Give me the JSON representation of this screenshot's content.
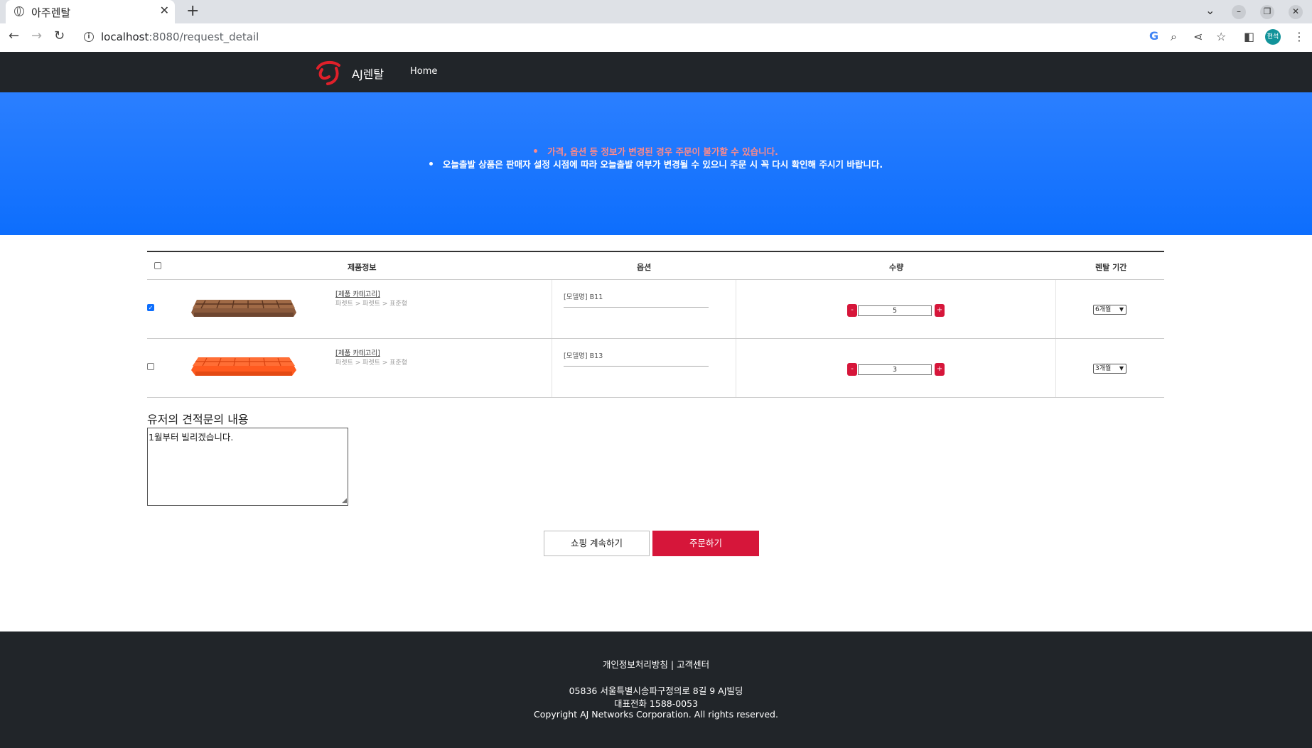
{
  "browser": {
    "tab_title": "아주렌탈",
    "url_host": "localhost",
    "url_rest": ":8080/request_detail",
    "profile_initials": "현석"
  },
  "nav": {
    "brand": "AJ렌탈",
    "home": "Home"
  },
  "hero": {
    "notice_1": "가격, 옵션 등 정보가 변경된 경우 주문이 불가할 수 있습니다.",
    "notice_2": "오늘출발 상품은 판매자 설정 시점에 따라 오늘출발 여부가 변경될 수 있으니 주문 시 꼭 다시 확인해 주시기 바랍니다.",
    "notice_1_color": "#ff8a8a",
    "background": "#0d6efd"
  },
  "table": {
    "headers": {
      "product": "제품정보",
      "option": "옵션",
      "quantity": "수량",
      "period": "렌탈 기간"
    },
    "rows": [
      {
        "checked": true,
        "category": "[제품 카테고리]",
        "breadcrumb": "파렛트 > 파렛트 > 표준형",
        "option": "[모델명] B11",
        "quantity": "5",
        "period": "6개월",
        "image_color": "brown-pallet"
      },
      {
        "checked": false,
        "category": "[제품 카테고리]",
        "breadcrumb": "파렛트 > 파렛트 > 표준형",
        "option": "[모델명] B13",
        "quantity": "3",
        "period": "3개월",
        "image_color": "orange-pallet"
      }
    ],
    "minus": "-",
    "plus": "+"
  },
  "quote": {
    "title": "유저의 견적문의 내용",
    "content": "1월부터 빌리겠습니다."
  },
  "actions": {
    "continue_label": "쇼핑 계속하기",
    "order_label": "주문하기",
    "accent": "#d6163a"
  },
  "footer": {
    "links": "개인정보처리방침 | 고객센터",
    "address": "05836 서울특별시송파구정의로 8길 9 AJ빌딩",
    "phone": "대표전화 1588-0053",
    "copyright": "Copyright AJ Networks Corporation. All rights reserved."
  }
}
